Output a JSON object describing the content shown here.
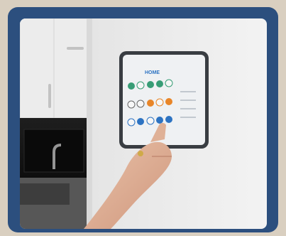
{
  "photo": {
    "tablet_screen": {
      "title": "HOME",
      "grid_rows": 3,
      "grid_cols": 5
    },
    "colors": {
      "frame": "#2c4f7e",
      "wall": "#f2f2f2",
      "tablet_bezel": "#3b3f45",
      "screen_bg": "#f7f9fb",
      "icon_green": "#3aa37a",
      "icon_orange": "#f08a2a",
      "icon_blue": "#2f77c9"
    }
  }
}
